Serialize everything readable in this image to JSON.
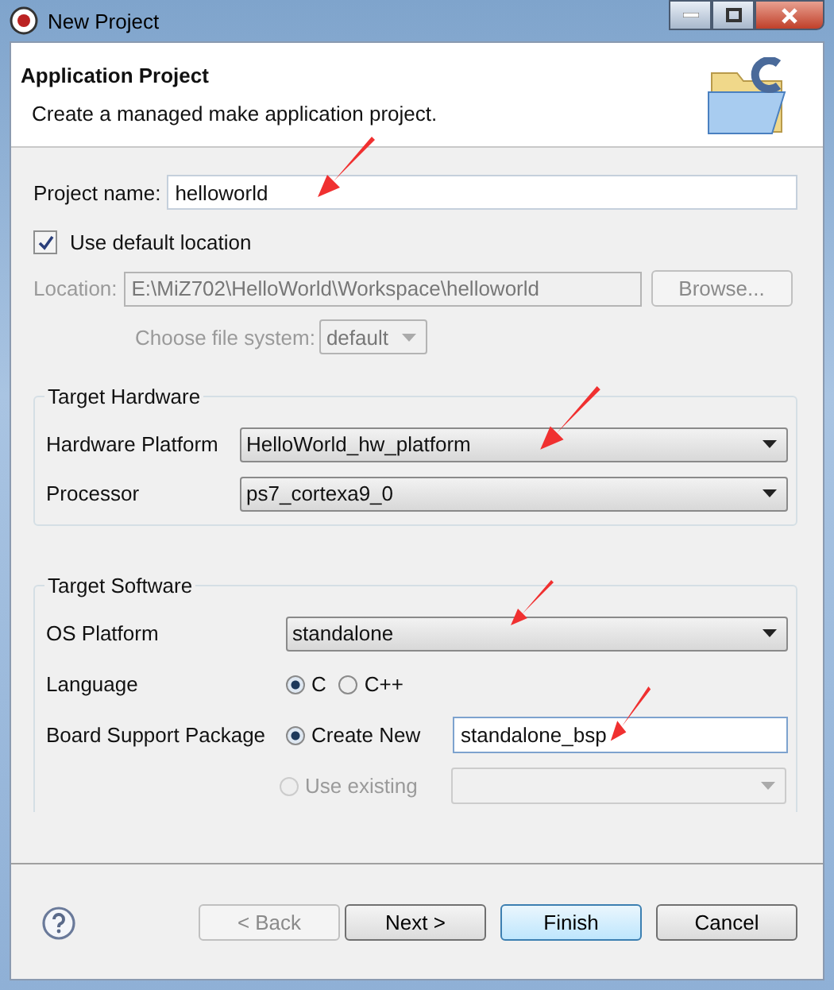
{
  "window": {
    "title": "New Project"
  },
  "header": {
    "title": "Application Project",
    "description": "Create a managed make application project."
  },
  "project_name": {
    "label": "Project name:",
    "value": "helloworld"
  },
  "use_default_location": {
    "label": "Use default location",
    "checked": true
  },
  "location": {
    "label": "Location:",
    "value": "E:\\MiZ702\\HelloWorld\\Workspace\\helloworld",
    "disabled": true,
    "browse": "Browse..."
  },
  "file_system": {
    "label": "Choose file system:",
    "value": "default",
    "disabled": true
  },
  "target_hardware": {
    "title": "Target Hardware",
    "fields": [
      {
        "label": "Hardware Platform",
        "value": "HelloWorld_hw_platform"
      },
      {
        "label": "Processor",
        "value": "ps7_cortexa9_0"
      }
    ]
  },
  "target_software": {
    "title": "Target Software",
    "os_platform": {
      "label": "OS Platform",
      "value": "standalone"
    },
    "language": {
      "label": "Language",
      "options": [
        {
          "label": "C",
          "selected": true
        },
        {
          "label": "C++",
          "selected": false
        }
      ]
    },
    "bsp": {
      "label": "Board Support Package",
      "options": [
        {
          "kind": "field",
          "label": "Create New",
          "selected": true,
          "disabled": false,
          "value": "standalone_bsp"
        },
        {
          "kind": "combo",
          "label": "Use existing",
          "selected": false,
          "disabled": true
        }
      ]
    }
  },
  "buttons": [
    {
      "label": "< Back",
      "disabled": true,
      "default": false
    },
    {
      "label": "Next >",
      "disabled": false,
      "default": false
    },
    {
      "label": "Finish",
      "disabled": false,
      "default": true
    },
    {
      "label": "Cancel",
      "disabled": false,
      "default": false
    }
  ]
}
